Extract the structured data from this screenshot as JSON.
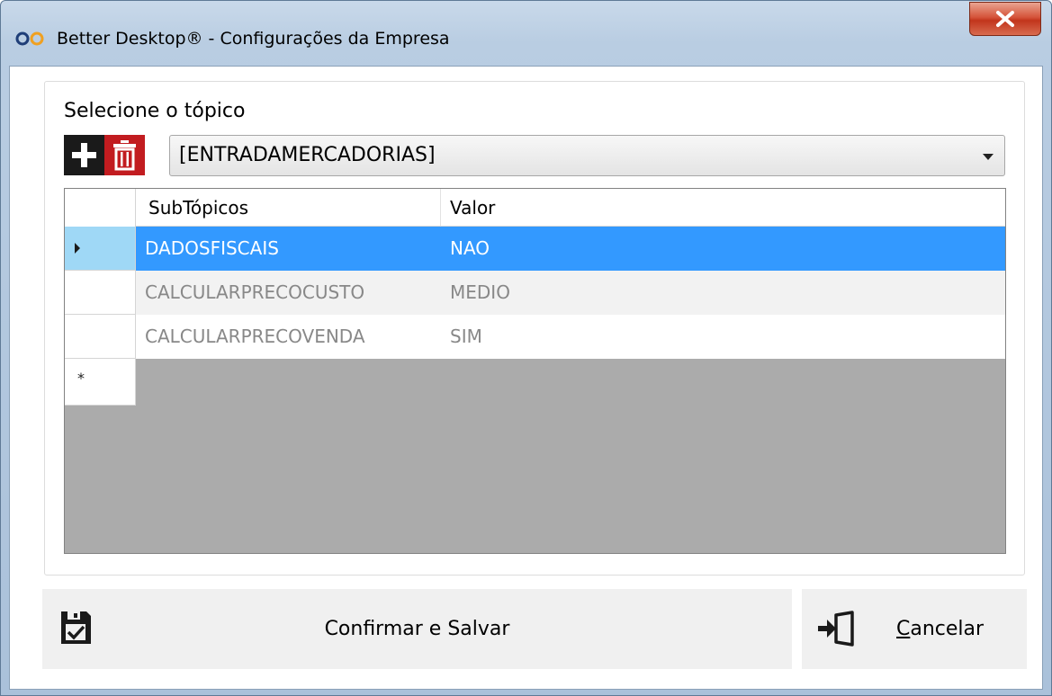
{
  "window": {
    "title": "Better Desktop® - Configurações da Empresa",
    "logo_icon": "infinity-logo-icon",
    "close_icon": "close-icon"
  },
  "topic": {
    "label": "Selecione o tópico",
    "add_icon": "plus-icon",
    "delete_icon": "trash-icon",
    "selected": "[ENTRADAMERCADORIAS]"
  },
  "grid": {
    "columns": [
      "SubTópicos",
      "Valor"
    ],
    "rows": [
      {
        "subtopico": "DADOSFISCAIS",
        "valor": "NAO"
      },
      {
        "subtopico": "CALCULARPRECOCUSTO",
        "valor": "MEDIO"
      },
      {
        "subtopico": "CALCULARPRECOVENDA",
        "valor": "SIM"
      }
    ],
    "new_row_marker": "*"
  },
  "actions": {
    "save_label": "Confirmar e Salvar",
    "save_icon": "save-check-icon",
    "cancel_label_mnemonic": "C",
    "cancel_label_rest": "ancelar",
    "cancel_icon": "exit-door-icon"
  },
  "colors": {
    "selection": "#3399ff",
    "current_row_header": "#9fd8f6",
    "delete_button": "#c21c20",
    "add_button": "#1a1a1a"
  }
}
